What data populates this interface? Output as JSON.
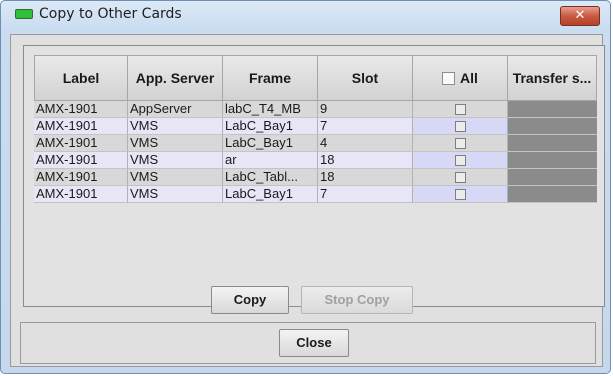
{
  "window": {
    "title": "Copy to Other Cards",
    "close_glyph": "✕"
  },
  "table": {
    "headers": [
      "Label",
      "App. Server",
      "Frame",
      "Slot",
      "All",
      "Transfer s..."
    ],
    "rows": [
      [
        "AMX-1901",
        "AppServer",
        "labC_T4_MB",
        "9"
      ],
      [
        "AMX-1901",
        "VMS",
        "LabC_Bay1",
        "7"
      ],
      [
        "AMX-1901",
        "VMS",
        "LabC_Bay1",
        "4"
      ],
      [
        "AMX-1901",
        "VMS",
        "ar",
        "18"
      ],
      [
        "AMX-1901",
        "VMS",
        "LabC_Tabl...",
        "18"
      ],
      [
        "AMX-1901",
        "VMS",
        "LabC_Bay1",
        "7"
      ]
    ],
    "row_checked": [
      false,
      false,
      false,
      false,
      false,
      false
    ],
    "all_checked": false
  },
  "buttons": {
    "copy": "Copy",
    "stop_copy": "Stop Copy",
    "close": "Close"
  },
  "colors": {
    "title_icon": "#2fbf3a",
    "close_button": "#c75a42",
    "transfer_status_fill": "#8b8b8b",
    "row_alt": "#e6e6f7"
  }
}
